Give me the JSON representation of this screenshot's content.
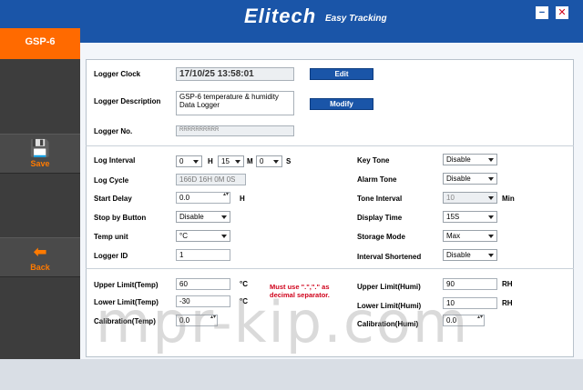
{
  "window": {
    "brand": "Elitech",
    "tagline": "Easy Tracking",
    "minimize": "−",
    "close": "✕"
  },
  "sidebar": {
    "device": "GSP-6",
    "save_label": "Save",
    "save_icon": "floppy-disk-icon",
    "back_label": "Back",
    "back_icon": "arrow-left-icon"
  },
  "clock": {
    "label": "Logger Clock",
    "value": "17/10/25 13:58:01",
    "edit_label": "Edit",
    "desc_label": "Logger Description",
    "desc_value": "GSP-6 temperature & humidity Data Logger",
    "modify_label": "Modify",
    "no_label": "Logger No.",
    "no_value": "RRRRRRRRRR"
  },
  "settings": {
    "log_interval_label": "Log Interval",
    "li_hours": "0",
    "li_h": "H",
    "li_minutes": "15",
    "li_m": "M",
    "li_seconds": "0",
    "li_s": "S",
    "log_cycle_label": "Log Cycle",
    "log_cycle_value": "166D 16H 0M 0S",
    "start_delay_label": "Start Delay",
    "start_delay_value": "0.0",
    "start_delay_unit": "H",
    "stop_button_label": "Stop by Button",
    "stop_button_value": "Disable",
    "temp_unit_label": "Temp unit",
    "temp_unit_value": "°C",
    "logger_id_label": "Logger ID",
    "logger_id_value": "1",
    "key_tone_label": "Key Tone",
    "key_tone_value": "Disable",
    "alarm_tone_label": "Alarm Tone",
    "alarm_tone_value": "Disable",
    "tone_interval_label": "Tone Interval",
    "tone_interval_value": "10",
    "tone_interval_unit": "Min",
    "display_time_label": "Display Time",
    "display_time_value": "15S",
    "storage_mode_label": "Storage Mode",
    "storage_mode_value": "Max",
    "interval_shortened_label": "Interval Shortened",
    "interval_shortened_value": "Disable"
  },
  "limits": {
    "upper_temp_label": "Upper Limit(Temp)",
    "upper_temp_value": "60",
    "upper_temp_unit": "°C",
    "lower_temp_label": "Lower Limit(Temp)",
    "lower_temp_value": "-30",
    "lower_temp_unit": "°C",
    "cal_temp_label": "Calibration(Temp)",
    "cal_temp_value": "0.0",
    "warning": "Must use \".\",\".\" as decimal separator.",
    "upper_humi_label": "Upper Limit(Humi)",
    "upper_humi_value": "90",
    "upper_humi_unit": "RH",
    "lower_humi_label": "Lower Limit(Humi)",
    "lower_humi_value": "10",
    "lower_humi_unit": "RH",
    "cal_humi_label": "Calibration(Humi)",
    "cal_humi_value": "0.0"
  },
  "watermark": "mpr-kip.com"
}
